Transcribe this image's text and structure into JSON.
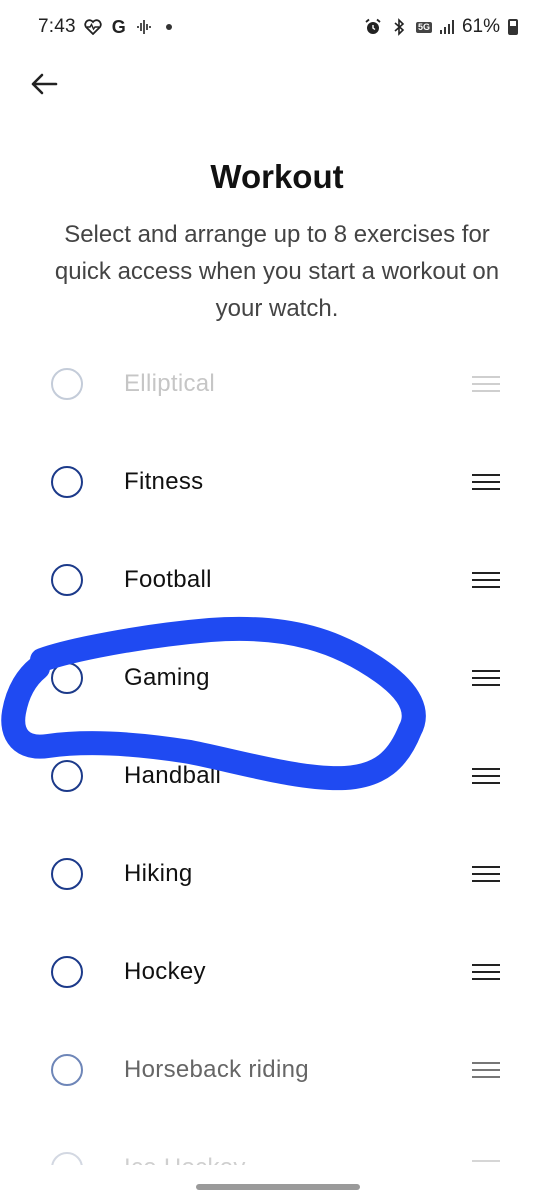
{
  "status_bar": {
    "time": "7:43",
    "g_label": "G",
    "network": "5G",
    "battery": "61%"
  },
  "header": {
    "title": "Workout",
    "description": "Select and arrange up to 8 exercises for quick access when you start a workout on your watch."
  },
  "exercises": [
    {
      "label": "Elliptical",
      "state": "faded"
    },
    {
      "label": "Fitness",
      "state": "normal"
    },
    {
      "label": "Football",
      "state": "normal"
    },
    {
      "label": "Gaming",
      "state": "normal"
    },
    {
      "label": "Handball",
      "state": "normal"
    },
    {
      "label": "Hiking",
      "state": "normal"
    },
    {
      "label": "Hockey",
      "state": "normal"
    },
    {
      "label": "Horseback riding",
      "state": "semi"
    },
    {
      "label": "Ice Hockey",
      "state": "cut"
    }
  ],
  "icons": {
    "back": "arrow-left-icon",
    "drag": "drag-handle-icon"
  },
  "colors": {
    "radio_border": "#1c3a8a",
    "annotation": "#1f4af2"
  }
}
